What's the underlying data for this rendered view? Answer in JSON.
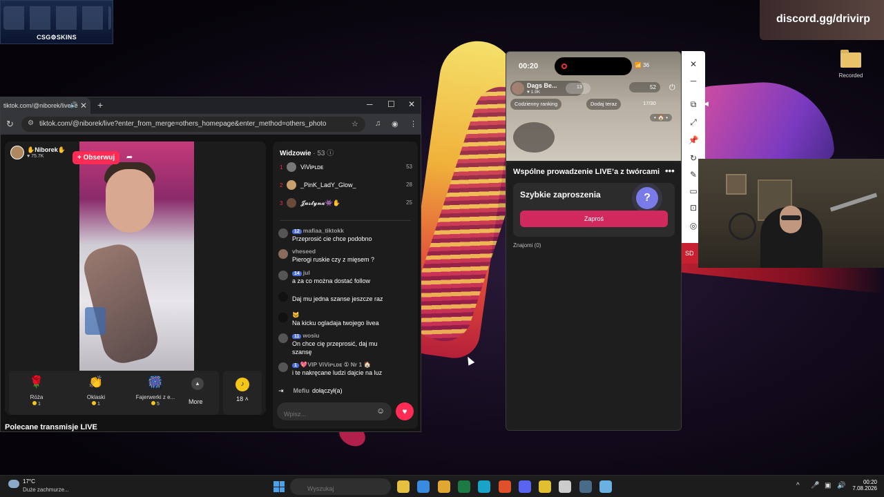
{
  "overlays": {
    "csgo_banner": "CSG⚙SKINS",
    "discord_banner": "discord.gg/drivirp",
    "desktop_folder": "Recorded"
  },
  "browser": {
    "tab_title": "tiktok.com/@niborek/live?e",
    "url": "tiktok.com/@niborek/live?enter_from_merge=others_homepage&enter_method=others_photo"
  },
  "stream": {
    "streamer_name": "✋Niborek✋",
    "likes": "♥ 75.7K",
    "follow_label": "+ Obserwuj",
    "gifts": [
      {
        "name": "Róża",
        "price": "1",
        "icon": "🌹"
      },
      {
        "name": "Oklaski",
        "price": "1",
        "icon": "👏"
      },
      {
        "name": "Fajerwerki z e...",
        "price": "5",
        "icon": "🎆"
      }
    ],
    "more_label": "More",
    "coins": "18 ˄",
    "recommended_label": "Polecane transmisje LIVE"
  },
  "chat": {
    "viewers_title": "Widzowie",
    "viewers_count": "· 53 ⓘ",
    "top_viewers": [
      {
        "rank": "1",
        "name": "ViViᴘʟᴅᴇ",
        "score": "53"
      },
      {
        "rank": "2",
        "name": "_PinK_LadY_Glow_",
        "score": "28"
      },
      {
        "rank": "3",
        "name": "𝓙𝓾𝓼𝓽𝔂𝓷𝓪👾✋",
        "score": "25"
      }
    ],
    "messages": [
      {
        "badge": "12",
        "user": "mafiaa_tiktokk",
        "text": "Przeprosić cie chce podobno"
      },
      {
        "badge": "",
        "user": "vheseed",
        "text": "Pierogi ruskie czy z mięsem ?"
      },
      {
        "badge": "14",
        "user": "jul",
        "text": "a za co można dostać follow"
      },
      {
        "badge": "",
        "user": "",
        "text": "Daj mu jedna szanse jeszcze raz"
      },
      {
        "badge": "",
        "user": "🐱",
        "text": "Na kicku ogladaja twojego livea"
      },
      {
        "badge": "11",
        "user": "wosiu",
        "text": "On chce cię przeprosić, daj mu szansę"
      },
      {
        "badge": "1",
        "user": "💖VIP ViViᴘʟᴅᴇ ① Nr 1 🏠",
        "text": "i te nakręcane ludzi dajcie na luz"
      }
    ],
    "joined_user": "Mefiu",
    "joined_text": "dołączył(a)",
    "input_placeholder": "Wpisz..."
  },
  "phone": {
    "time": "00:20",
    "status": "📶 36",
    "host_name": "Dags Be...",
    "host_likes": "♥ 1.9K",
    "host_badge": "13",
    "viewers": "52",
    "pill_ranking": "Codzienny ranking",
    "pill_add": "Dodaj teraz",
    "count": "17/30",
    "dots": "• 🏠 •",
    "cohost_title": "Wspólne prowadzenie LIVE’a z twórcami",
    "quick_invites": "Szybkie zaproszenia",
    "invite_button": "Zaproś",
    "friends": "Znajomi (0)"
  },
  "side": {
    "sd_label": "SD"
  },
  "taskbar": {
    "temp": "17°C",
    "weather": "Duże zachmurze...",
    "search_placeholder": "Wyszukaj",
    "time": "00:20",
    "date": "7.08.2026",
    "apps": [
      {
        "name": "file-explorer",
        "color": "#e8c040"
      },
      {
        "name": "store",
        "color": "#3a8ae0"
      },
      {
        "name": "folder",
        "color": "#e0a830"
      },
      {
        "name": "excel",
        "color": "#1e7a45"
      },
      {
        "name": "edge",
        "color": "#1aa3c8"
      },
      {
        "name": "brave",
        "color": "#e0502a"
      },
      {
        "name": "discord",
        "color": "#5865f2"
      },
      {
        "name": "chrome",
        "color": "#e0c030"
      },
      {
        "name": "opera",
        "color": "#ccc"
      },
      {
        "name": "steam",
        "color": "#4a6a8a"
      },
      {
        "name": "app",
        "color": "#6ab0e0"
      }
    ]
  }
}
